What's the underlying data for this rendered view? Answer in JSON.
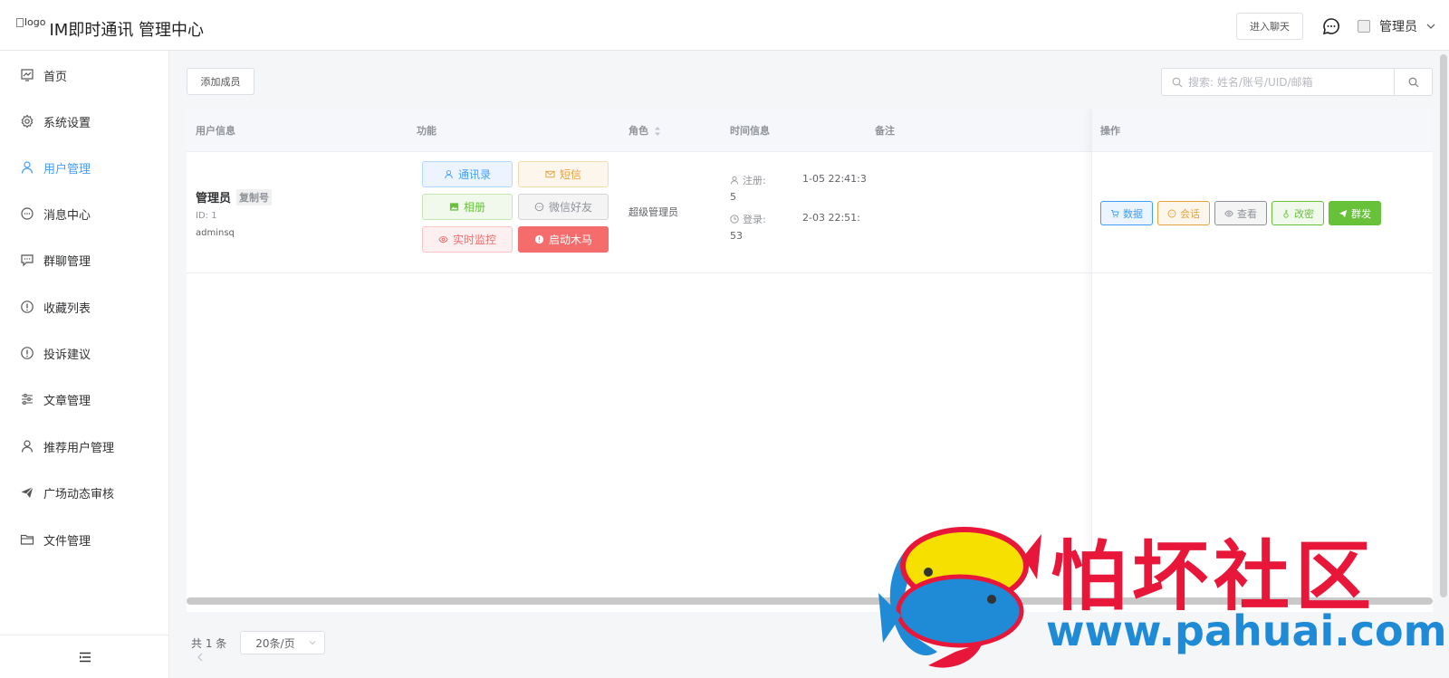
{
  "header": {
    "logo_alt": "logo",
    "title": "IM即时通讯 管理中心",
    "enter_chat": "进入聊天",
    "admin_name": "管理员"
  },
  "sidebar": {
    "items": [
      {
        "label": "首页",
        "icon": "chart-icon"
      },
      {
        "label": "系统设置",
        "icon": "gear-icon"
      },
      {
        "label": "用户管理",
        "icon": "user-icon"
      },
      {
        "label": "消息中心",
        "icon": "chat-icon"
      },
      {
        "label": "群聊管理",
        "icon": "group-chat-icon"
      },
      {
        "label": "收藏列表",
        "icon": "info-icon"
      },
      {
        "label": "投诉建议",
        "icon": "info-icon"
      },
      {
        "label": "文章管理",
        "icon": "sliders-icon"
      },
      {
        "label": "推荐用户管理",
        "icon": "user-icon"
      },
      {
        "label": "广场动态审核",
        "icon": "send-icon"
      },
      {
        "label": "文件管理",
        "icon": "folder-icon"
      }
    ],
    "active_index": 2
  },
  "toolbar": {
    "add_member": "添加成员",
    "search_placeholder": "搜索: 姓名/账号/UID/邮箱"
  },
  "table": {
    "headers": {
      "user_info": "用户信息",
      "functions": "功能",
      "role": "角色",
      "time_info": "时间信息",
      "remark": "备注",
      "actions": "操作"
    },
    "rows": [
      {
        "name": "管理员",
        "copy_label": "复制号",
        "id_text": "ID: 1",
        "account": "adminsq",
        "func_buttons": [
          "通讯录",
          "短信",
          "相册",
          "微信好友",
          "实时监控",
          "启动木马"
        ],
        "role": "超级管理员",
        "register_label": "注册:",
        "register_value_1": "1-05 22:41:3",
        "register_value_2": "5",
        "login_label": "登录:",
        "login_value_1": "2-03 22:51:",
        "login_value_2": "53",
        "actions": [
          "数据",
          "会话",
          "查看",
          "改密",
          "群发"
        ]
      }
    ]
  },
  "pager": {
    "total": "共 1 条",
    "page_size": "20条/页"
  },
  "watermark": {
    "title": "怕坏社区",
    "url": "www.pahuai.com"
  },
  "colors": {
    "primary": "#409eff",
    "success": "#67c23a",
    "warning": "#e6a23c",
    "danger": "#f56c6c",
    "watermark_red": "#e8173a",
    "watermark_blue": "#1f8ad6"
  }
}
